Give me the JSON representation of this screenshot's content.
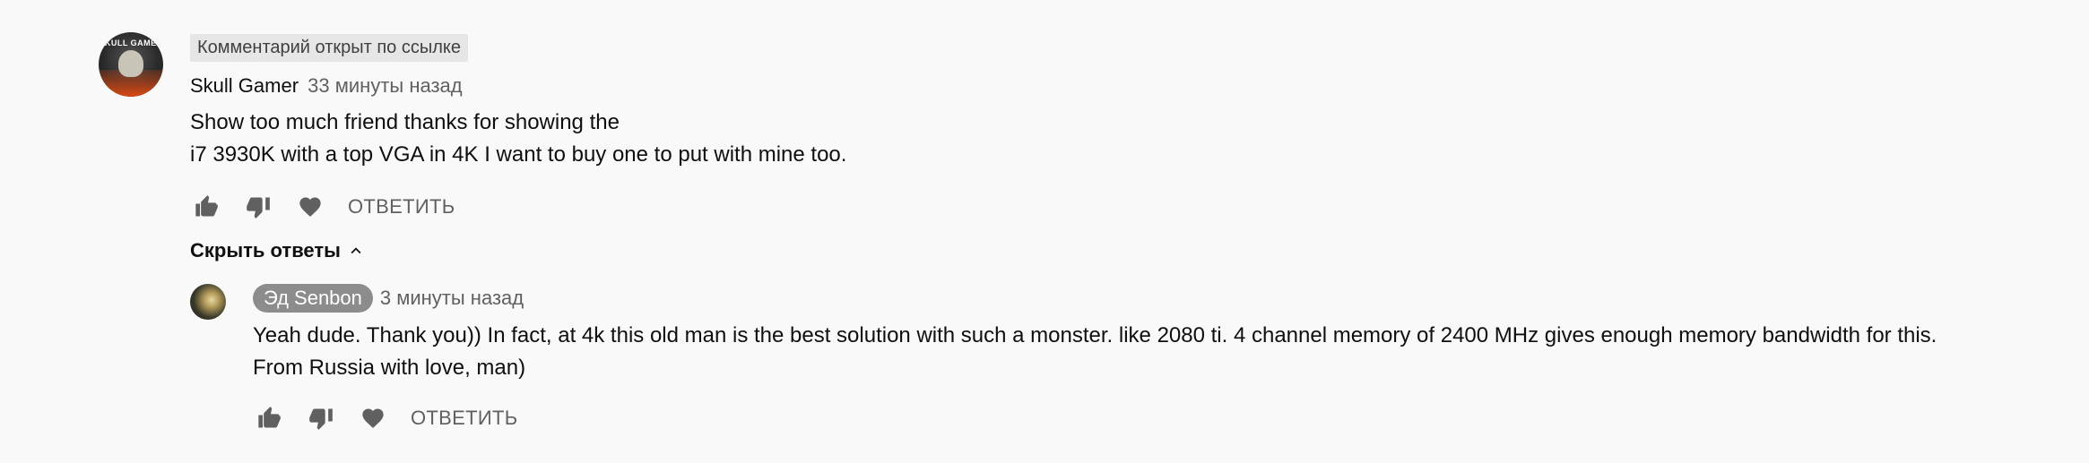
{
  "comment": {
    "pinned_label": "Комментарий открыт по ссылке",
    "author": "Skull Gamer",
    "time": "33 минуты назад",
    "lines": [
      "Show too much friend thanks for showing the",
      "i7 3930K with a top VGA in 4K I want to buy one to put with mine too."
    ],
    "reply_label": "ОТВЕТИТЬ",
    "avatar_text": "SKULL GAMER"
  },
  "hide_replies_label": "Скрыть ответы",
  "reply": {
    "author": "Эд Senbon",
    "time": "3 минуты назад",
    "lines": [
      "Yeah dude.  Thank you)) In fact, at 4k this old man is the best solution with such a monster.  like 2080 ti.  4 channel memory of 2400 MHz gives enough memory bandwidth for this.",
      "From Russia with love, man)"
    ],
    "reply_label": "ОТВЕТИТЬ"
  },
  "icons": {
    "like": "thumbs-up-icon",
    "dislike": "thumbs-down-icon",
    "heart": "heart-icon",
    "chevron": "chevron-up-icon"
  },
  "colors": {
    "background": "#f9f9f9",
    "secondary_text": "#606060",
    "author_chip": "#8c8c8c",
    "pinned_tag_bg": "#e6e6e6"
  }
}
